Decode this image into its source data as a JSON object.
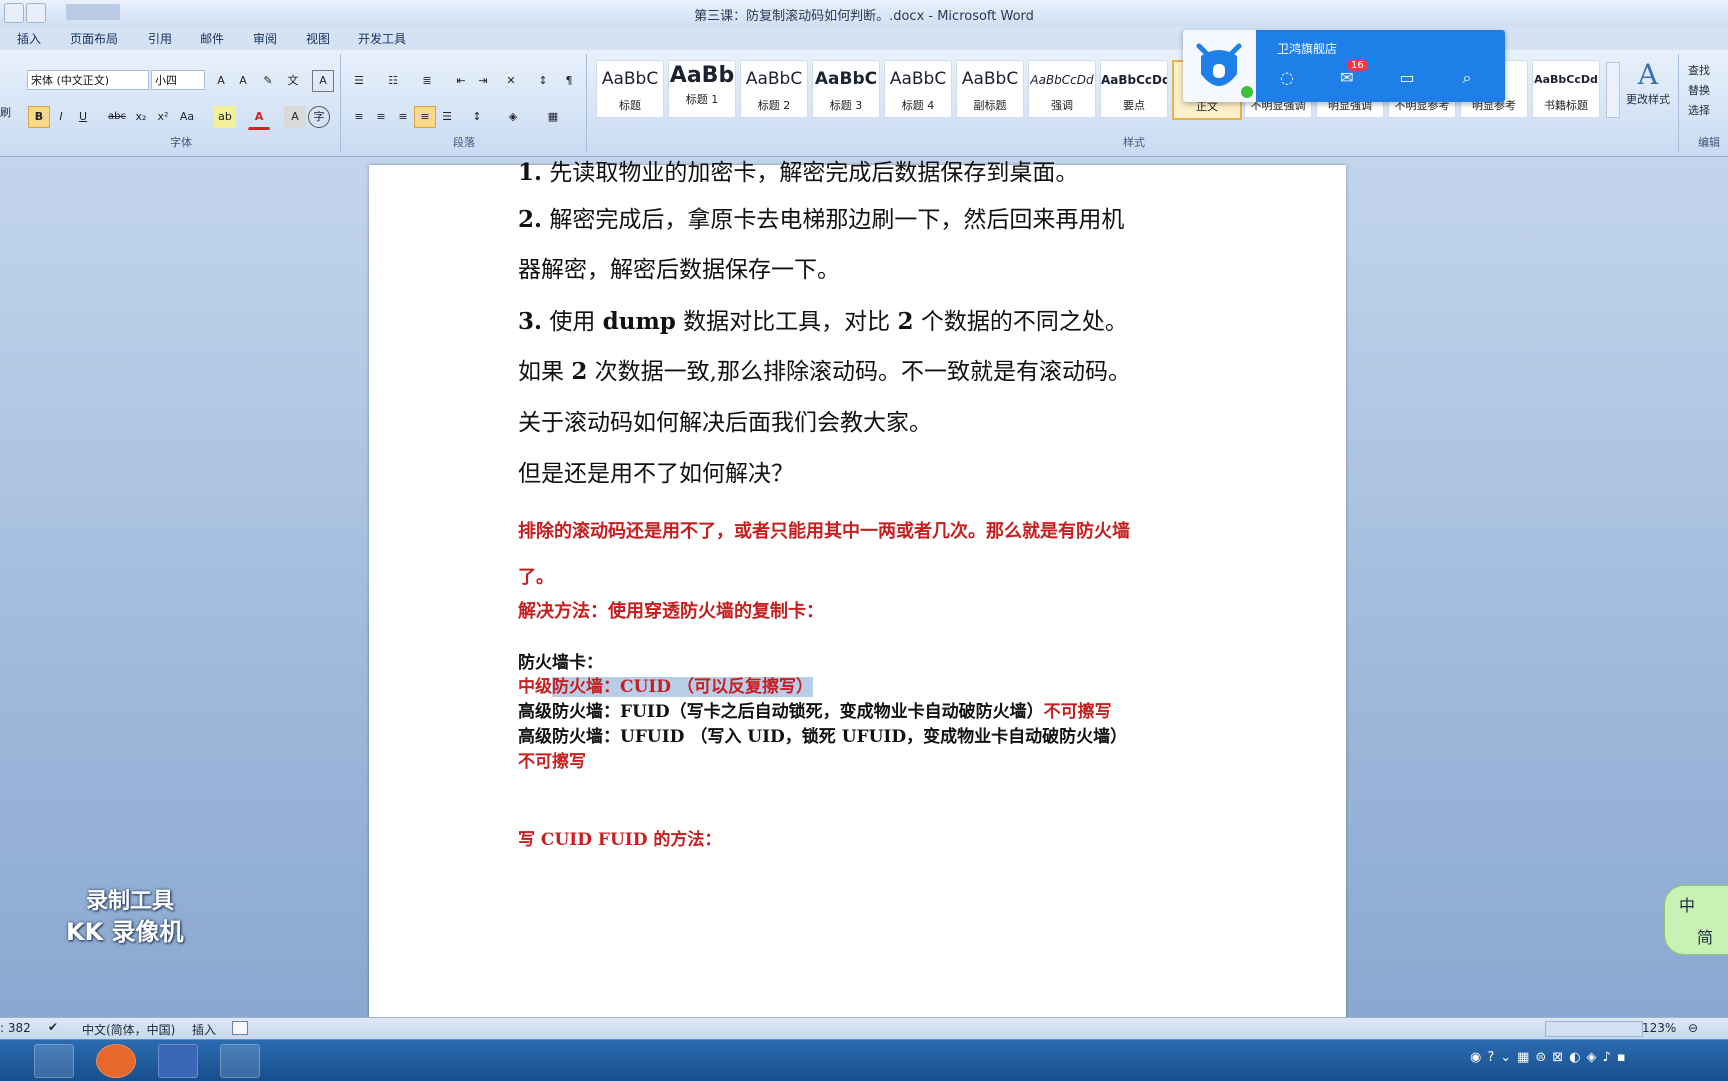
{
  "window": {
    "title": "第三课：防复制滚动码如何判断。.docx - Microsoft Word"
  },
  "tabs": [
    "插入",
    "页面布局",
    "引用",
    "邮件",
    "审阅",
    "视图",
    "开发工具"
  ],
  "font_group": {
    "label": "字体",
    "font_name": "宋体 (中文正文)",
    "font_size": "小四",
    "buttons": [
      "B",
      "I",
      "U",
      "abc",
      "x₂",
      "x²",
      "Aa",
      "A",
      "A"
    ]
  },
  "paragraph_group": {
    "label": "段落"
  },
  "styles_group": {
    "label": "样式",
    "change_styles": "更改样式",
    "styles": [
      {
        "sample": "AaBbC",
        "name": "标题"
      },
      {
        "sample": "AaBb",
        "name": "标题 1"
      },
      {
        "sample": "AaBbC",
        "name": "标题 2"
      },
      {
        "sample": "AaBbC",
        "name": "标题 3"
      },
      {
        "sample": "AaBbC",
        "name": "标题 4"
      },
      {
        "sample": "AaBbC",
        "name": "副标题"
      },
      {
        "sample": "AaBbCcDd",
        "name": "强调"
      },
      {
        "sample": "AaBbCcDd",
        "name": "要点"
      },
      {
        "sample": "A",
        "name": "正文"
      },
      {
        "sample": "",
        "name": "不明显强调"
      },
      {
        "sample": "",
        "name": "明显强调"
      },
      {
        "sample": "",
        "name": "不明显参考"
      },
      {
        "sample": "Dd",
        "name": "明显参考"
      },
      {
        "sample": "AaBbCcDd",
        "name": "书籍标题"
      }
    ]
  },
  "editing_group": {
    "label": "编辑",
    "items": [
      "查找",
      "替换",
      "选择"
    ]
  },
  "left_clip": {
    "clipboard_fragment": "刷"
  },
  "popup": {
    "name": "卫鸿旗舰店",
    "badge": "16"
  },
  "document": {
    "lines": [
      {
        "num": "1.",
        "text": "先读取物业的加密卡，解密完成后数据保存到桌面。"
      },
      {
        "num": "2.",
        "text": "解密完成后，拿原卡去电梯那边刷一下，然后回来再用机"
      },
      {
        "text": "器解密，解密后数据保存一下。"
      },
      {
        "num": "3.",
        "pre": "使用 ",
        "b1": "dump",
        "mid": " 数据对比工具，对比 ",
        "b2": "2",
        "post": " 个数据的不同之处。"
      },
      {
        "pre": "如果 ",
        "b1": "2",
        "post": " 次数据一致,那么排除滚动码。不一致就是有滚动码。"
      },
      {
        "text": "关于滚动码如何解决后面我们会教大家。"
      },
      {
        "text": "但是还是用不了如何解决？"
      }
    ],
    "red_para_1": "排除的滚动码还是用不了，或者只能用其中一两或者几次。那么就是有防火墙",
    "red_para_1b": "了。",
    "solution": "解决方法：使用穿透防火墙的复制卡：",
    "firewall_title": "防火墙卡：",
    "mid_a": "中级",
    "mid_b": "防火墙：CUID （可以反复擦写）",
    "high1_a": "高级防火墙：FUID（写卡之后自动锁死，变成物业卡自动破防火墙）",
    "high1_b": "不可擦写",
    "high2": "高级防火墙：UFUID （写入 UID，锁死 UFUID，变成物业卡自动破防火墙）",
    "high2_b": "不可擦写",
    "method": "写 CUID FUID 的方法："
  },
  "watermark": {
    "line1": "录制工具",
    "line2": "KK 录像机"
  },
  "ime": {
    "top": "中",
    "bottom": "简"
  },
  "status": {
    "words": ": 382",
    "lang": "中文(简体，中国)",
    "mode": "插入",
    "zoom": "123%"
  }
}
